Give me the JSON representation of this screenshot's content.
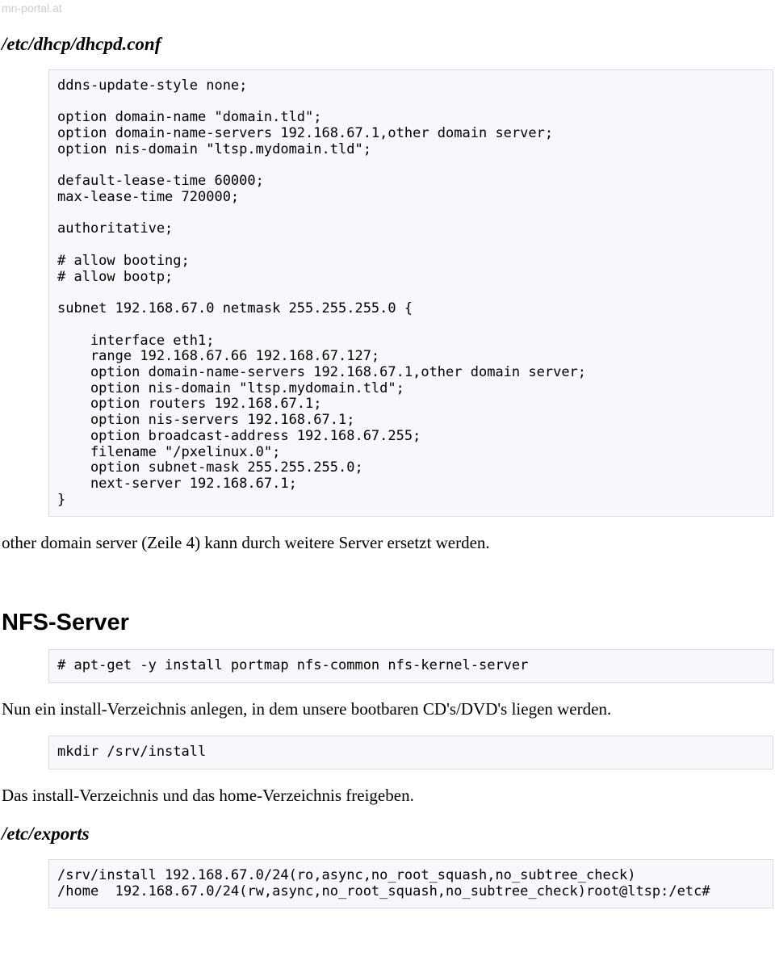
{
  "watermark": "mn-portal.at",
  "heading1": "/etc/dhcp/dhcpd.conf",
  "code1": "ddns-update-style none;\n\noption domain-name \"domain.tld\";\noption domain-name-servers 192.168.67.1,other domain server;\noption nis-domain \"ltsp.mydomain.tld\";\n\ndefault-lease-time 60000;\nmax-lease-time 720000;\n\nauthoritative;\n\n# allow booting;\n# allow bootp;\n\nsubnet 192.168.67.0 netmask 255.255.255.0 {\n\n    interface eth1;\n    range 192.168.67.66 192.168.67.127;\n    option domain-name-servers 192.168.67.1,other domain server;\n    option nis-domain \"ltsp.mydomain.tld\";\n    option routers 192.168.67.1;\n    option nis-servers 192.168.67.1;\n    option broadcast-address 192.168.67.255;\n    filename \"/pxelinux.0\";\n    option subnet-mask 255.255.255.0;\n    next-server 192.168.67.1;\n}",
  "para1": "other domain server (Zeile 4) kann durch weitere Server ersetzt werden.",
  "section2": "NFS-Server",
  "code2": "# apt-get -y install portmap nfs-common nfs-kernel-server",
  "para2": "Nun ein install-Verzeichnis anlegen, in dem unsere bootbaren CD's/DVD's liegen werden.",
  "code3": "mkdir /srv/install",
  "para3": "Das install-Verzeichnis und das home-Verzeichnis freigeben.",
  "heading2": "/etc/exports",
  "code4": "/srv/install 192.168.67.0/24(ro,async,no_root_squash,no_subtree_check)\n/home  192.168.67.0/24(rw,async,no_root_squash,no_subtree_check)root@ltsp:/etc#"
}
